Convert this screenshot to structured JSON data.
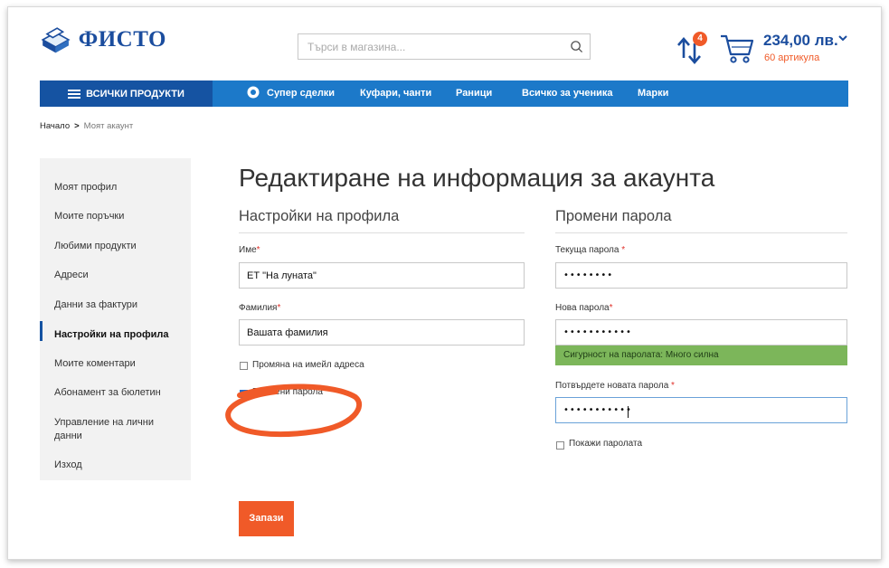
{
  "brand": {
    "name": "ФИСТО",
    "color": "#1b4d9e"
  },
  "search": {
    "placeholder": "Търси в магазина..."
  },
  "header": {
    "compare_count": "4",
    "cart_total": "234,00 лв.",
    "cart_items": "60 артикула"
  },
  "nav": {
    "all_products": "ВСИЧКИ ПРОДУКТИ",
    "items": [
      "Супер сделки",
      "Куфари, чанти",
      "Раници",
      "Всичко за ученика",
      "Марки"
    ],
    "colors": {
      "bar": "#1c79c9",
      "all": "#1553a2"
    }
  },
  "breadcrumb": {
    "home": "Начало",
    "separator": ">",
    "current": "Моят акаунт"
  },
  "sidebar": {
    "items": [
      "Моят профил",
      "Моите поръчки",
      "Любими продукти",
      "Адреси",
      "Данни за фактури",
      "Настройки на профила",
      "Моите коментари",
      "Абонамент за бюлетин",
      "Управление на лични данни",
      "Изход"
    ],
    "active": "Настройки на профила"
  },
  "page": {
    "title": "Редактиране на информация за акаунта"
  },
  "profile": {
    "section_title": "Настройки на профила",
    "first_name_label": "Име",
    "first_name_value": "ЕТ \"На луната\"",
    "last_name_label": "Фамилия",
    "last_name_value": "Вашата фамилия",
    "required_mark": "*",
    "change_email_label": "Промяна на имейл адреса",
    "change_email_checked": false,
    "change_password_label": "Промени парола",
    "change_password_checked": true
  },
  "password": {
    "section_title": "Промени парола",
    "current_label": "Текуща парола",
    "current_value": "••••••••",
    "new_label": "Нова парола",
    "new_value": "•••••••••••",
    "strength_text": "Сигурност на паролата: Много силна",
    "confirm_label": "Потвърдете новата парола",
    "confirm_value": "•••••••••••",
    "required_mark": "*",
    "show_password_label": "Покажи паролата",
    "show_password_checked": false
  },
  "actions": {
    "save_label": "Запази",
    "save_color": "#f05a28"
  },
  "annotation": {
    "color": "#f05a28"
  }
}
